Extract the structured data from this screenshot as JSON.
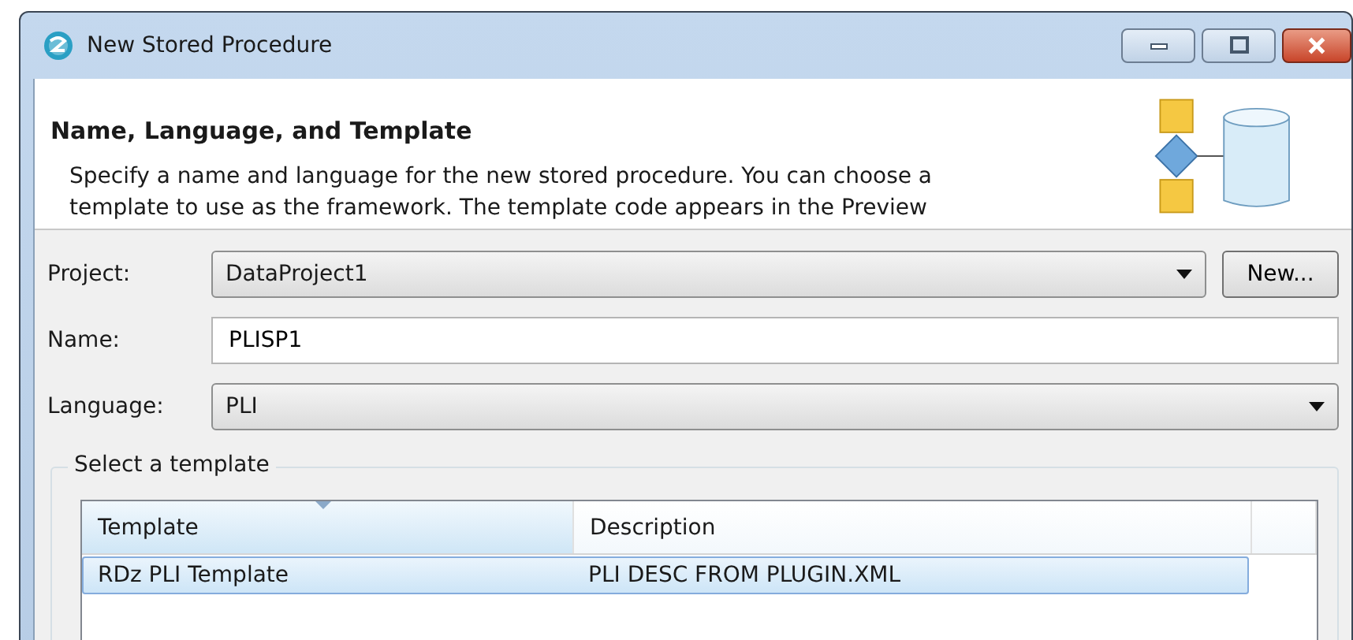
{
  "window": {
    "title": "New Stored Procedure"
  },
  "header": {
    "title": "Name, Language, and Template",
    "description_lines": [
      "Specify a name and language for the new stored procedure. You can choose a",
      "template to use as the framework. The template code appears in the Preview"
    ]
  },
  "form": {
    "project": {
      "label": "Project:",
      "value": "DataProject1",
      "button": "New..."
    },
    "name": {
      "label": "Name:",
      "value": "PLISP1"
    },
    "language": {
      "label": "Language:",
      "value": "PLI"
    }
  },
  "template_group": {
    "title": "Select a template",
    "table": {
      "columns": [
        {
          "label": "Template",
          "sorted": true
        },
        {
          "label": "Description",
          "sorted": false
        }
      ],
      "rows": [
        {
          "cells": [
            "RDz PLI Template",
            "PLI DESC FROM PLUGIN.XML"
          ],
          "selected": true
        }
      ]
    }
  }
}
